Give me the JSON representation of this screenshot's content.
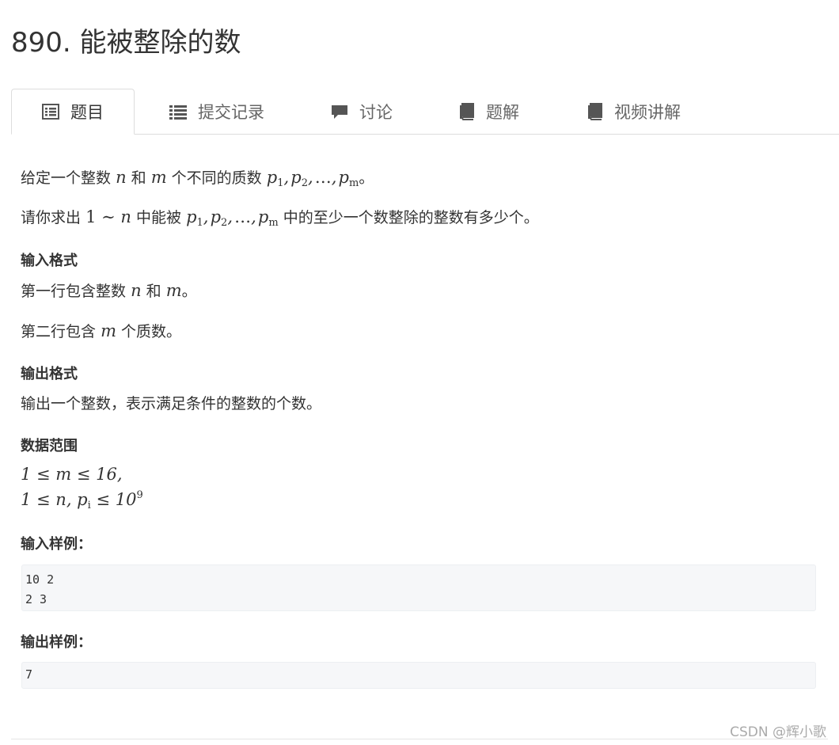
{
  "title": "890. 能被整除的数",
  "tabs": [
    {
      "label": "题目",
      "icon": "problem-list-icon",
      "active": true
    },
    {
      "label": "提交记录",
      "icon": "list-icon"
    },
    {
      "label": "讨论",
      "icon": "comment-icon"
    },
    {
      "label": "题解",
      "icon": "book-icon"
    },
    {
      "label": "视频讲解",
      "icon": "book-icon"
    }
  ],
  "problem": {
    "line1_prefix": "给定一个整数",
    "line1_and": "和",
    "line1_mid": "个不同的质数",
    "line1_end": "。",
    "line2_prefix": "请你求出",
    "line2_mid": "中能被",
    "line2_end": "中的至少一个数整除的整数有多少个。",
    "var_n": "n",
    "var_m": "m",
    "seq_p": "p",
    "one": "1",
    "tilde": "∼",
    "ellipsis": "…"
  },
  "input_format": {
    "heading": "输入格式",
    "line1_prefix": "第一行包含整数",
    "line1_and": "和",
    "line1_end": "。",
    "line2_prefix": "第二行包含",
    "line2_end": "个质数。"
  },
  "output_format": {
    "heading": "输出格式",
    "text": "输出一个整数，表示满足条件的整数的个数。"
  },
  "data_range": {
    "heading": "数据范围",
    "range1": "1 ≤ m ≤ 16,",
    "range2_left": "1 ≤ n, p",
    "range2_sub": "i",
    "range2_mid": " ≤ 10",
    "range2_sup": "9"
  },
  "sample_input": {
    "heading": "输入样例：",
    "lines": [
      "10 2",
      "2 3"
    ]
  },
  "sample_output": {
    "heading": "输出样例：",
    "lines": [
      "7"
    ]
  },
  "watermark": "CSDN @辉小歌",
  "colors": {
    "text": "#333333",
    "tab_inactive": "#666666",
    "icon": "#555555",
    "code_bg": "#f6f7f9"
  }
}
